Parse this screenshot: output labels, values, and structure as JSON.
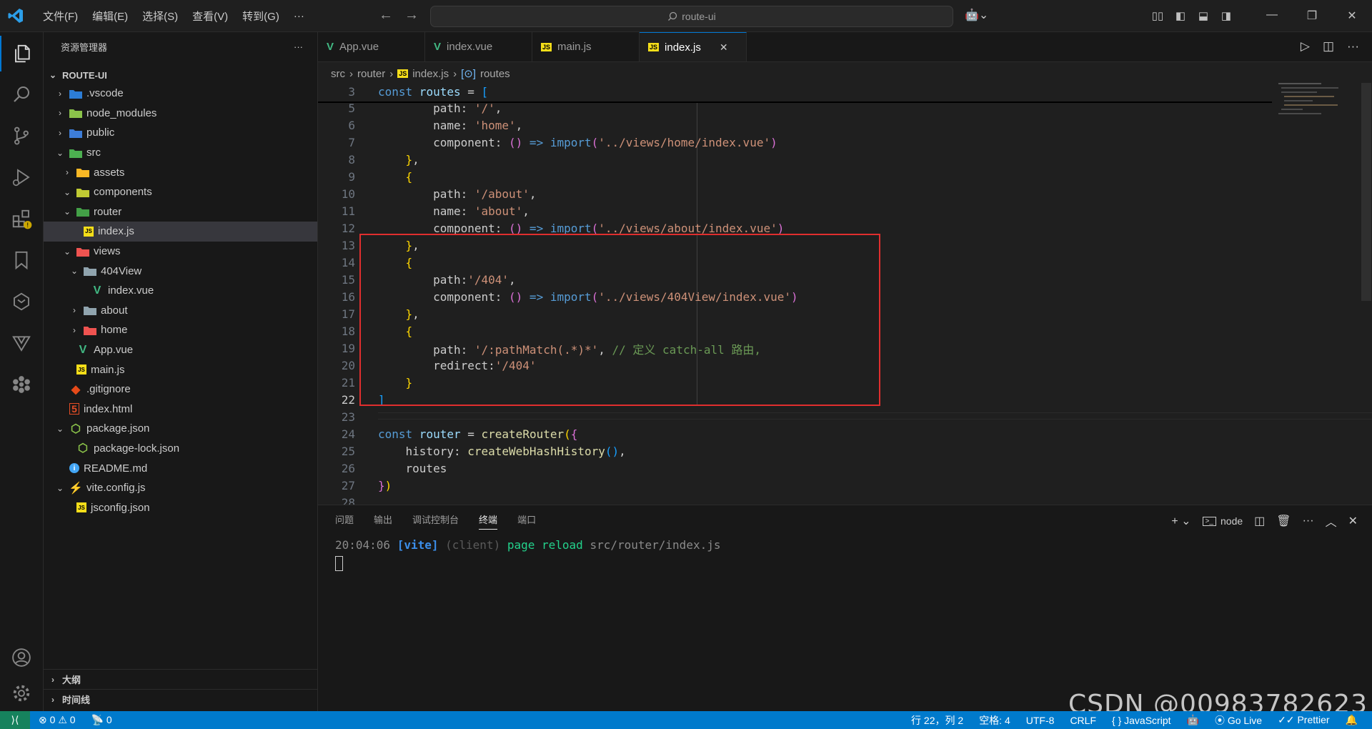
{
  "titlebar": {
    "menu": [
      "文件(F)",
      "编辑(E)",
      "选择(S)",
      "查看(V)",
      "转到(G)",
      "···"
    ],
    "search": "route-ui"
  },
  "sidebar": {
    "title": "资源管理器",
    "more": "···",
    "root": "ROUTE-UI",
    "items": [
      {
        "label": ".vscode",
        "chev": "›",
        "icon": "vscode-folder-icon",
        "color": "#2c7dd6"
      },
      {
        "label": "node_modules",
        "chev": "›",
        "icon": "node-folder-icon",
        "color": "#8bc34a"
      },
      {
        "label": "public",
        "chev": "›",
        "icon": "public-folder-icon",
        "color": "#3d7dd8"
      },
      {
        "label": "src",
        "chev": "⌄",
        "icon": "src-folder-icon",
        "color": "#4caf50"
      },
      {
        "label": "assets",
        "chev": "›",
        "icon": "assets-folder-icon",
        "color": "#f9b825"
      },
      {
        "label": "components",
        "chev": "⌄",
        "icon": "components-folder-icon",
        "color": "#c0ca33"
      },
      {
        "label": "router",
        "chev": "⌄",
        "icon": "router-folder-icon",
        "color": "#43a047"
      },
      {
        "label": "index.js",
        "chev": "",
        "icon": "js-file-icon",
        "color": "#f5de19"
      },
      {
        "label": "views",
        "chev": "⌄",
        "icon": "views-folder-icon",
        "color": "#ef5350"
      },
      {
        "label": "404View",
        "chev": "⌄",
        "icon": "folder-icon",
        "color": "#90a4ae"
      },
      {
        "label": "index.vue",
        "chev": "",
        "icon": "vue-file-icon",
        "color": "#41b883"
      },
      {
        "label": "about",
        "chev": "›",
        "icon": "folder-icon",
        "color": "#90a4ae"
      },
      {
        "label": "home",
        "chev": "›",
        "icon": "home-folder-icon",
        "color": "#ef5350"
      },
      {
        "label": "App.vue",
        "chev": "",
        "icon": "vue-file-icon",
        "color": "#41b883"
      },
      {
        "label": "main.js",
        "chev": "",
        "icon": "js-file-icon",
        "color": "#f5de19"
      },
      {
        "label": ".gitignore",
        "chev": "",
        "icon": "git-icon",
        "color": "#e64a19"
      },
      {
        "label": "index.html",
        "chev": "",
        "icon": "html-file-icon",
        "color": "#e44d26"
      },
      {
        "label": "package.json",
        "chev": "⌄",
        "icon": "nodejs-icon",
        "color": "#8bc34a"
      },
      {
        "label": "package-lock.json",
        "chev": "",
        "icon": "nodejs-icon",
        "color": "#8bc34a"
      },
      {
        "label": "README.md",
        "chev": "",
        "icon": "info-icon",
        "color": "#42a5f5"
      },
      {
        "label": "vite.config.js",
        "chev": "⌄",
        "icon": "vite-icon",
        "color": "#ffc107"
      },
      {
        "label": "jsconfig.json",
        "chev": "",
        "icon": "js-file-icon",
        "color": "#f5de19"
      }
    ],
    "outline": "大纲",
    "timeline": "时间线"
  },
  "tabs": [
    {
      "label": "App.vue",
      "icon": "vue-file-icon"
    },
    {
      "label": "index.vue",
      "icon": "vue-file-icon"
    },
    {
      "label": "main.js",
      "icon": "js-file-icon"
    },
    {
      "label": "index.js",
      "icon": "js-file-icon",
      "close": "✕"
    }
  ],
  "breadcrumb": [
    "src",
    "router",
    "index.js",
    "routes"
  ],
  "editor": {
    "line_numbers": [
      "3",
      "5",
      "6",
      "7",
      "8",
      "9",
      "10",
      "11",
      "12",
      "13",
      "14",
      "15",
      "16",
      "17",
      "18",
      "19",
      "20",
      "21",
      "22",
      "23",
      "24",
      "25",
      "26",
      "27",
      "28"
    ]
  },
  "panel": {
    "tabs": [
      "问题",
      "输出",
      "调试控制台",
      "终端",
      "端口"
    ],
    "shell": "node",
    "terminal": {
      "time": "20:04:06",
      "tag": "[vite]",
      "client": "(client)",
      "msg": "page reload",
      "path": "src/router/index.js"
    }
  },
  "status": {
    "errors": "0",
    "warnings": "0",
    "ports": "0",
    "position": "行 22，列 2",
    "spaces": "空格: 4",
    "encoding": "UTF-8",
    "eol": "CRLF",
    "language": "JavaScript",
    "golive": "Go Live",
    "prettier": "Prettier"
  },
  "watermark": "CSDN @00983782623",
  "colors": {
    "accent": "#007acc",
    "annotation": "#e02e2e"
  }
}
